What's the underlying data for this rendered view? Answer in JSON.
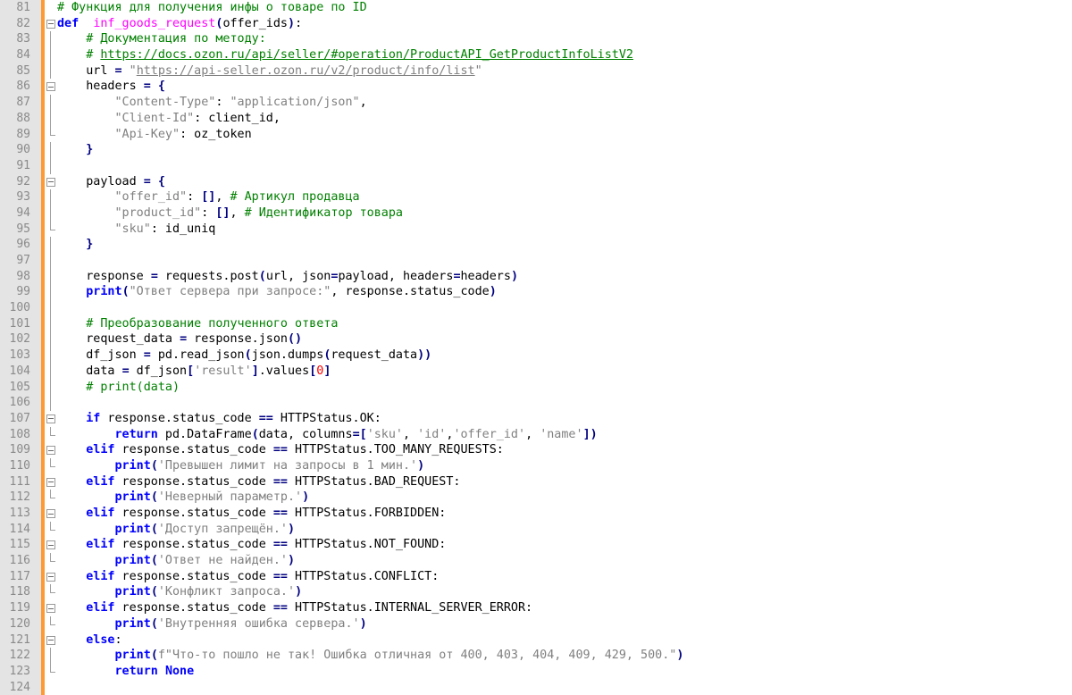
{
  "editor": {
    "lines": [
      {
        "n": "81",
        "fold": "none",
        "segs": [
          [
            "cm",
            "# Функция для получения инфы о товаре по ID"
          ]
        ]
      },
      {
        "n": "82",
        "fold": "box",
        "segs": [
          [
            "kw",
            "def"
          ],
          [
            "",
            "  "
          ],
          [
            "fn",
            "inf_goods_request"
          ],
          [
            "op",
            "("
          ],
          [
            "",
            "offer_ids"
          ],
          [
            "op",
            ")"
          ],
          [
            "",
            ":"
          ]
        ]
      },
      {
        "n": "83",
        "fold": "vline",
        "segs": [
          [
            "",
            "    "
          ],
          [
            "cm",
            "# Документация по методу:"
          ]
        ]
      },
      {
        "n": "84",
        "fold": "vline",
        "segs": [
          [
            "",
            "    "
          ],
          [
            "cm",
            "# "
          ],
          [
            "cm ul",
            "https://docs.ozon.ru/api/seller/#operation/ProductAPI_GetProductInfoListV2"
          ]
        ]
      },
      {
        "n": "85",
        "fold": "vline",
        "segs": [
          [
            "",
            "    url "
          ],
          [
            "op",
            "="
          ],
          [
            "",
            " "
          ],
          [
            "st",
            "\""
          ],
          [
            "st ul",
            "https://api-seller.ozon.ru/v2/product/info/list"
          ],
          [
            "st",
            "\""
          ]
        ]
      },
      {
        "n": "86",
        "fold": "box",
        "segs": [
          [
            "",
            "    headers "
          ],
          [
            "op",
            "="
          ],
          [
            "",
            " "
          ],
          [
            "op",
            "{"
          ]
        ]
      },
      {
        "n": "87",
        "fold": "vline",
        "segs": [
          [
            "",
            "        "
          ],
          [
            "st",
            "\"Content-Type\""
          ],
          [
            "",
            ": "
          ],
          [
            "st",
            "\"application/json\""
          ],
          [
            "",
            ","
          ]
        ]
      },
      {
        "n": "88",
        "fold": "vline",
        "segs": [
          [
            "",
            "        "
          ],
          [
            "st",
            "\"Client-Id\""
          ],
          [
            "",
            ": client_id,"
          ]
        ]
      },
      {
        "n": "89",
        "fold": "end",
        "segs": [
          [
            "",
            "        "
          ],
          [
            "st",
            "\"Api-Key\""
          ],
          [
            "",
            ": oz_token"
          ]
        ]
      },
      {
        "n": "90",
        "fold": "vline",
        "segs": [
          [
            "",
            "    "
          ],
          [
            "op",
            "}"
          ]
        ]
      },
      {
        "n": "91",
        "fold": "vline",
        "segs": []
      },
      {
        "n": "92",
        "fold": "box",
        "segs": [
          [
            "",
            "    payload "
          ],
          [
            "op",
            "="
          ],
          [
            "",
            " "
          ],
          [
            "op",
            "{"
          ]
        ]
      },
      {
        "n": "93",
        "fold": "vline",
        "segs": [
          [
            "",
            "        "
          ],
          [
            "st",
            "\"offer_id\""
          ],
          [
            "",
            ": "
          ],
          [
            "op",
            "[]"
          ],
          [
            "",
            ", "
          ],
          [
            "cm",
            "# Артикул продавца"
          ]
        ]
      },
      {
        "n": "94",
        "fold": "vline",
        "segs": [
          [
            "",
            "        "
          ],
          [
            "st",
            "\"product_id\""
          ],
          [
            "",
            ": "
          ],
          [
            "op",
            "[]"
          ],
          [
            "",
            ", "
          ],
          [
            "cm",
            "# Идентификатор товара"
          ]
        ]
      },
      {
        "n": "95",
        "fold": "end",
        "segs": [
          [
            "",
            "        "
          ],
          [
            "st",
            "\"sku\""
          ],
          [
            "",
            ": id_uniq"
          ]
        ]
      },
      {
        "n": "96",
        "fold": "vline",
        "segs": [
          [
            "",
            "    "
          ],
          [
            "op",
            "}"
          ]
        ]
      },
      {
        "n": "97",
        "fold": "vline",
        "segs": []
      },
      {
        "n": "98",
        "fold": "vline",
        "segs": [
          [
            "",
            "    response "
          ],
          [
            "op",
            "="
          ],
          [
            "",
            " requests.post"
          ],
          [
            "op",
            "("
          ],
          [
            "",
            "url, json"
          ],
          [
            "op",
            "="
          ],
          [
            "",
            "payload, headers"
          ],
          [
            "op",
            "="
          ],
          [
            "",
            "headers"
          ],
          [
            "op",
            ")"
          ]
        ]
      },
      {
        "n": "99",
        "fold": "vline",
        "segs": [
          [
            "",
            "    "
          ],
          [
            "kw",
            "print"
          ],
          [
            "op",
            "("
          ],
          [
            "st",
            "\"Ответ сервера при запросе:\""
          ],
          [
            "",
            ", response.status_code"
          ],
          [
            "op",
            ")"
          ]
        ]
      },
      {
        "n": "100",
        "fold": "vline",
        "segs": []
      },
      {
        "n": "101",
        "fold": "vline",
        "segs": [
          [
            "",
            "    "
          ],
          [
            "cm",
            "# Преобразование полученного ответа"
          ]
        ]
      },
      {
        "n": "102",
        "fold": "vline",
        "segs": [
          [
            "",
            "    request_data "
          ],
          [
            "op",
            "="
          ],
          [
            "",
            " response.json"
          ],
          [
            "op",
            "()"
          ]
        ]
      },
      {
        "n": "103",
        "fold": "vline",
        "segs": [
          [
            "",
            "    df_json "
          ],
          [
            "op",
            "="
          ],
          [
            "",
            " pd.read_json"
          ],
          [
            "op",
            "("
          ],
          [
            "",
            "json.dumps"
          ],
          [
            "op",
            "("
          ],
          [
            "",
            "request_data"
          ],
          [
            "op",
            "))"
          ]
        ]
      },
      {
        "n": "104",
        "fold": "vline",
        "segs": [
          [
            "",
            "    data "
          ],
          [
            "op",
            "="
          ],
          [
            "",
            " df_json"
          ],
          [
            "op",
            "["
          ],
          [
            "st",
            "'result'"
          ],
          [
            "op",
            "]"
          ],
          [
            "",
            ".values"
          ],
          [
            "op",
            "["
          ],
          [
            "nu",
            "0"
          ],
          [
            "op",
            "]"
          ]
        ]
      },
      {
        "n": "105",
        "fold": "vline",
        "segs": [
          [
            "",
            "    "
          ],
          [
            "cm",
            "# print(data)"
          ]
        ]
      },
      {
        "n": "106",
        "fold": "vline",
        "segs": []
      },
      {
        "n": "107",
        "fold": "box",
        "segs": [
          [
            "",
            "    "
          ],
          [
            "kw",
            "if"
          ],
          [
            "",
            " response.status_code "
          ],
          [
            "op",
            "=="
          ],
          [
            "",
            " HTTPStatus.OK:"
          ]
        ]
      },
      {
        "n": "108",
        "fold": "end",
        "segs": [
          [
            "",
            "        "
          ],
          [
            "kw",
            "return"
          ],
          [
            "",
            " pd.DataFrame"
          ],
          [
            "op",
            "("
          ],
          [
            "",
            "data, columns"
          ],
          [
            "op",
            "=["
          ],
          [
            "st",
            "'sku'"
          ],
          [
            "",
            ", "
          ],
          [
            "st",
            "'id'"
          ],
          [
            "",
            ","
          ],
          [
            "st",
            "'offer_id'"
          ],
          [
            "",
            ", "
          ],
          [
            "st",
            "'name'"
          ],
          [
            "op",
            "])"
          ]
        ]
      },
      {
        "n": "109",
        "fold": "box",
        "segs": [
          [
            "",
            "    "
          ],
          [
            "kw",
            "elif"
          ],
          [
            "",
            " response.status_code "
          ],
          [
            "op",
            "=="
          ],
          [
            "",
            " HTTPStatus.TOO_MANY_REQUESTS:"
          ]
        ]
      },
      {
        "n": "110",
        "fold": "end",
        "segs": [
          [
            "",
            "        "
          ],
          [
            "kw",
            "print"
          ],
          [
            "op",
            "("
          ],
          [
            "st",
            "'Превышен лимит на запросы в 1 мин.'"
          ],
          [
            "op",
            ")"
          ]
        ]
      },
      {
        "n": "111",
        "fold": "box",
        "segs": [
          [
            "",
            "    "
          ],
          [
            "kw",
            "elif"
          ],
          [
            "",
            " response.status_code "
          ],
          [
            "op",
            "=="
          ],
          [
            "",
            " HTTPStatus.BAD_REQUEST:"
          ]
        ]
      },
      {
        "n": "112",
        "fold": "end",
        "segs": [
          [
            "",
            "        "
          ],
          [
            "kw",
            "print"
          ],
          [
            "op",
            "("
          ],
          [
            "st",
            "'Неверный параметр.'"
          ],
          [
            "op",
            ")"
          ]
        ]
      },
      {
        "n": "113",
        "fold": "box",
        "segs": [
          [
            "",
            "    "
          ],
          [
            "kw",
            "elif"
          ],
          [
            "",
            " response.status_code "
          ],
          [
            "op",
            "=="
          ],
          [
            "",
            " HTTPStatus.FORBIDDEN:"
          ]
        ]
      },
      {
        "n": "114",
        "fold": "end",
        "segs": [
          [
            "",
            "        "
          ],
          [
            "kw",
            "print"
          ],
          [
            "op",
            "("
          ],
          [
            "st",
            "'Доступ запрещён.'"
          ],
          [
            "op",
            ")"
          ]
        ]
      },
      {
        "n": "115",
        "fold": "box",
        "segs": [
          [
            "",
            "    "
          ],
          [
            "kw",
            "elif"
          ],
          [
            "",
            " response.status_code "
          ],
          [
            "op",
            "=="
          ],
          [
            "",
            " HTTPStatus.NOT_FOUND:"
          ]
        ]
      },
      {
        "n": "116",
        "fold": "end",
        "segs": [
          [
            "",
            "        "
          ],
          [
            "kw",
            "print"
          ],
          [
            "op",
            "("
          ],
          [
            "st",
            "'Ответ не найден.'"
          ],
          [
            "op",
            ")"
          ]
        ]
      },
      {
        "n": "117",
        "fold": "box",
        "segs": [
          [
            "",
            "    "
          ],
          [
            "kw",
            "elif"
          ],
          [
            "",
            " response.status_code "
          ],
          [
            "op",
            "=="
          ],
          [
            "",
            " HTTPStatus.CONFLICT:"
          ]
        ]
      },
      {
        "n": "118",
        "fold": "end",
        "segs": [
          [
            "",
            "        "
          ],
          [
            "kw",
            "print"
          ],
          [
            "op",
            "("
          ],
          [
            "st",
            "'Конфликт запроса.'"
          ],
          [
            "op",
            ")"
          ]
        ]
      },
      {
        "n": "119",
        "fold": "box",
        "segs": [
          [
            "",
            "    "
          ],
          [
            "kw",
            "elif"
          ],
          [
            "",
            " response.status_code "
          ],
          [
            "op",
            "=="
          ],
          [
            "",
            " HTTPStatus.INTERNAL_SERVER_ERROR:"
          ]
        ]
      },
      {
        "n": "120",
        "fold": "end",
        "segs": [
          [
            "",
            "        "
          ],
          [
            "kw",
            "print"
          ],
          [
            "op",
            "("
          ],
          [
            "st",
            "'Внутренняя ошибка сервера.'"
          ],
          [
            "op",
            ")"
          ]
        ]
      },
      {
        "n": "121",
        "fold": "box",
        "segs": [
          [
            "",
            "    "
          ],
          [
            "kw",
            "else"
          ],
          [
            "",
            ":"
          ]
        ]
      },
      {
        "n": "122",
        "fold": "vline",
        "segs": [
          [
            "",
            "        "
          ],
          [
            "kw",
            "print"
          ],
          [
            "op",
            "("
          ],
          [
            "st",
            "f\"Что-то пошло не так! Ошибка отличная от 400, 403, 404, 409, 429, 500.\""
          ],
          [
            "op",
            ")"
          ]
        ]
      },
      {
        "n": "123",
        "fold": "end",
        "segs": [
          [
            "",
            "        "
          ],
          [
            "kw",
            "return"
          ],
          [
            "",
            " "
          ],
          [
            "kw",
            "None"
          ]
        ]
      },
      {
        "n": "124",
        "fold": "none",
        "segs": []
      }
    ]
  },
  "colors": {
    "gutter": "#e4e4e4",
    "change_bar": "#ff9933",
    "comment": "#008000",
    "keyword": "#0000ff",
    "string": "#808080",
    "function": "#ff00ff",
    "number": "#ff0000"
  }
}
